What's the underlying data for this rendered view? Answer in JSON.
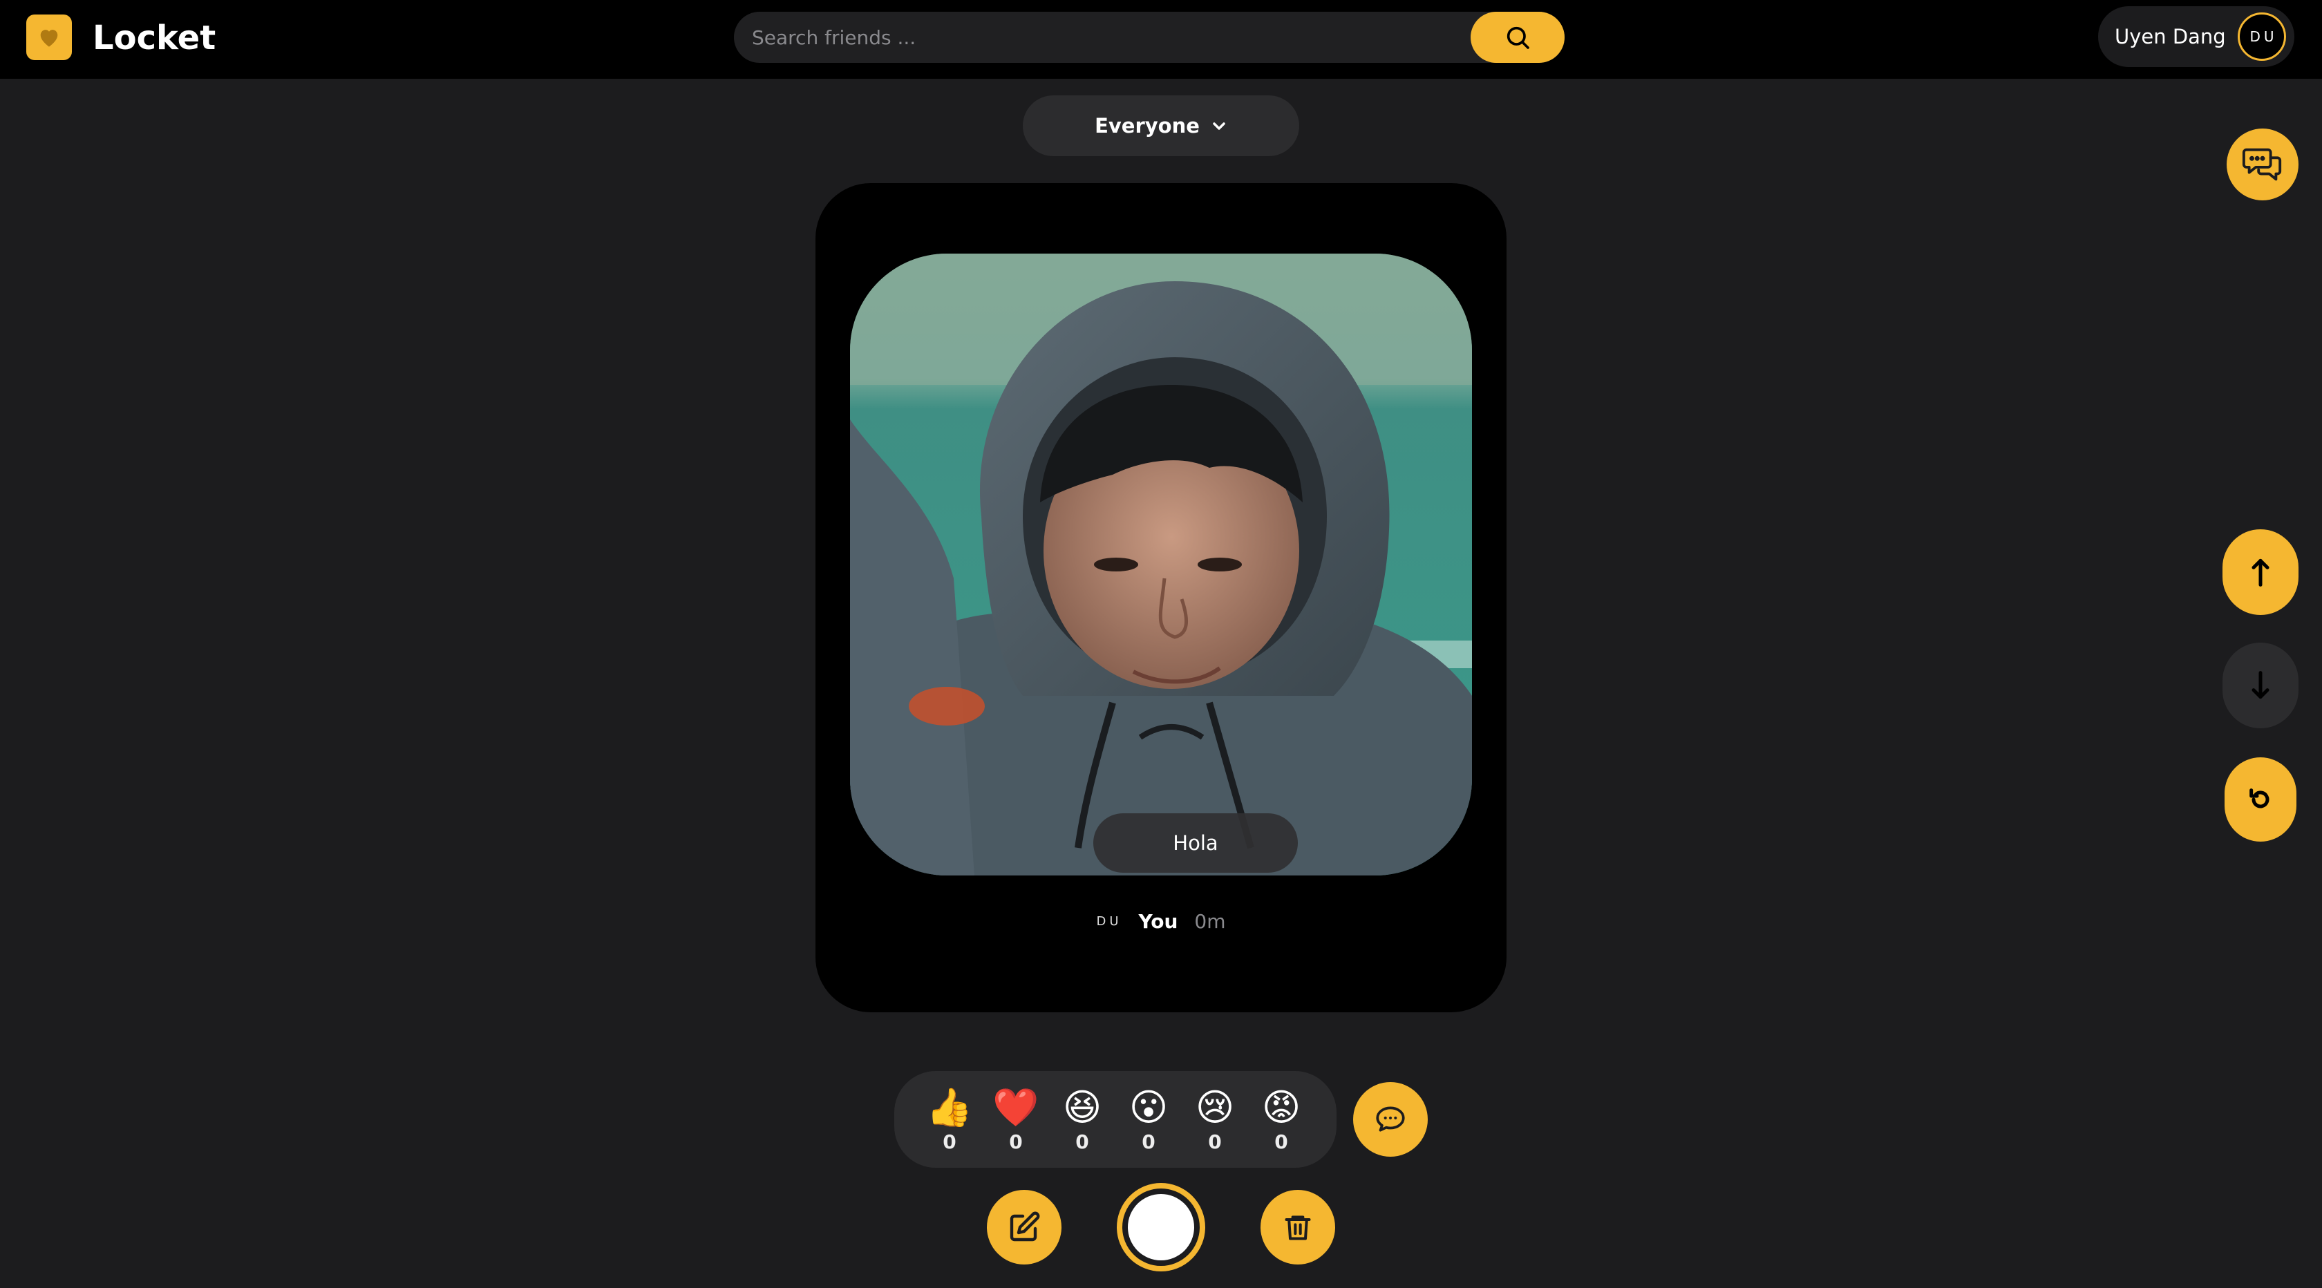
{
  "app": {
    "name": "Locket"
  },
  "colors": {
    "accent": "#f5b731",
    "background": "#1c1c1e",
    "topbar": "#000000",
    "card": "#000000",
    "pill": "#2c2c2e"
  },
  "header": {
    "logo_icon": "heart-icon",
    "search": {
      "placeholder": "Search friends ...",
      "value": "",
      "button_icon": "search-icon"
    },
    "user": {
      "name": "Uyen Dang",
      "initials": "DU"
    }
  },
  "filter": {
    "label": "Everyone",
    "icon": "chevron-down-icon"
  },
  "floating": {
    "chat_icon": "chat-bubbles-icon"
  },
  "post": {
    "image": "selfie-photo",
    "caption": "Hola",
    "author_initials": "DU",
    "author": "You",
    "time": "0m"
  },
  "side_controls": [
    {
      "icon": "arrow-up-icon"
    },
    {
      "icon": "arrow-down-icon"
    },
    {
      "icon": "refresh-icon"
    }
  ],
  "reactions": [
    {
      "name": "like",
      "emoji": "👍",
      "count": "0"
    },
    {
      "name": "love",
      "emoji": "❤️",
      "count": "0"
    },
    {
      "name": "haha",
      "emoji": "😆",
      "count": "0"
    },
    {
      "name": "wow",
      "emoji": "😮",
      "count": "0"
    },
    {
      "name": "sad",
      "emoji": "😢",
      "count": "0"
    },
    {
      "name": "angry",
      "emoji": "😡",
      "count": "0"
    }
  ],
  "actions": {
    "reply_icon": "message-icon",
    "edit_icon": "edit-icon",
    "delete_icon": "trash-icon",
    "shutter": "capture-button"
  }
}
